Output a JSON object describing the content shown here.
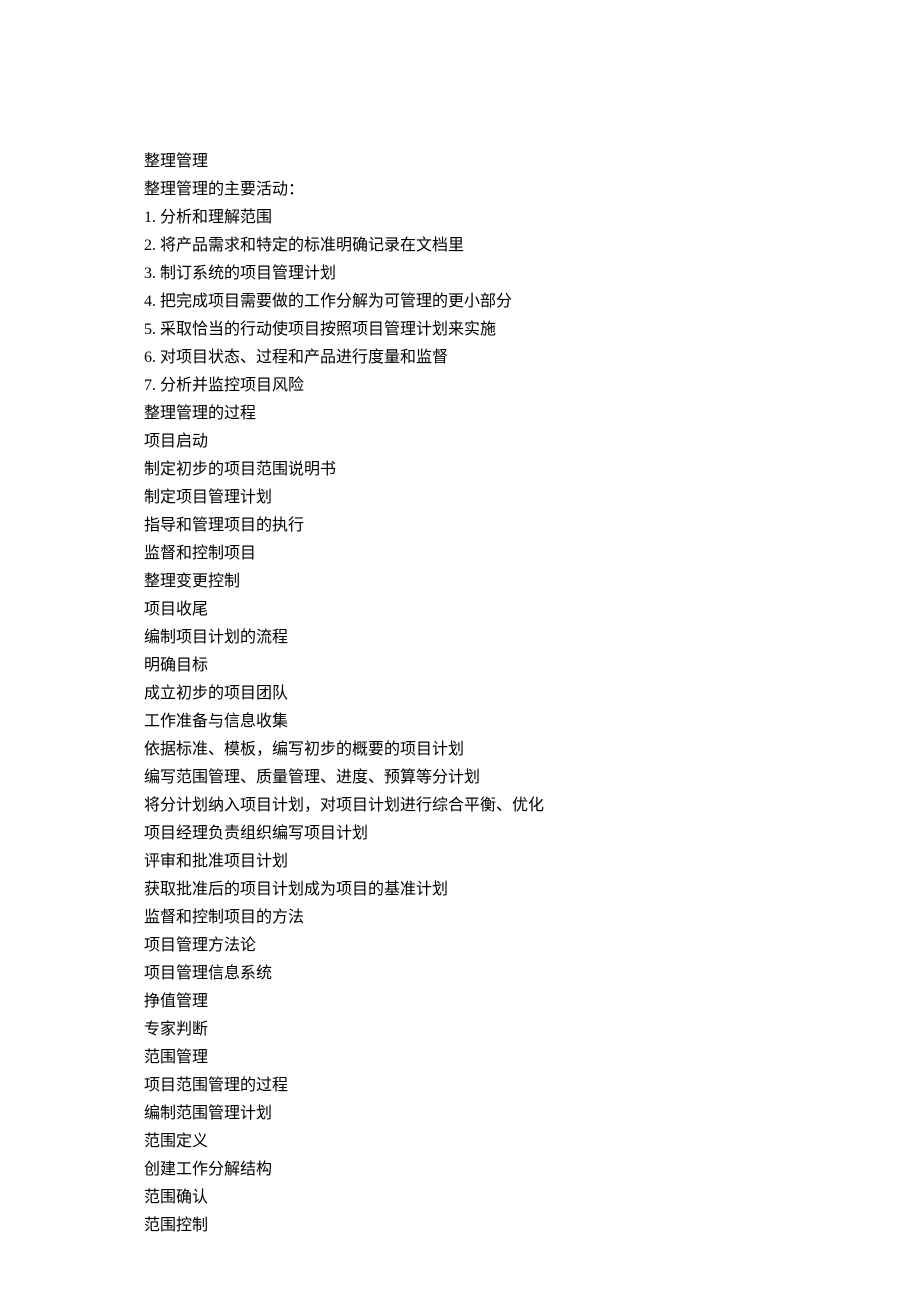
{
  "lines": [
    "整理管理",
    "整理管理的主要活动：",
    "1.  分析和理解范围",
    "2.  将产品需求和特定的标准明确记录在文档里",
    "3.  制订系统的项目管理计划",
    "4.  把完成项目需要做的工作分解为可管理的更小部分",
    "5.  采取恰当的行动使项目按照项目管理计划来实施",
    "6.  对项目状态、过程和产品进行度量和监督",
    "7.  分析并监控项目风险",
    "整理管理的过程",
    "项目启动",
    "制定初步的项目范围说明书",
    "制定项目管理计划",
    "指导和管理项目的执行",
    "监督和控制项目",
    "整理变更控制",
    "项目收尾",
    "编制项目计划的流程",
    "明确目标",
    "成立初步的项目团队",
    "工作准备与信息收集",
    "依据标准、模板，编写初步的概要的项目计划",
    "编写范围管理、质量管理、进度、预算等分计划",
    "将分计划纳入项目计划，对项目计划进行综合平衡、优化",
    "项目经理负责组织编写项目计划",
    "评审和批准项目计划",
    "获取批准后的项目计划成为项目的基准计划",
    "监督和控制项目的方法",
    "项目管理方法论",
    "项目管理信息系统",
    "挣值管理",
    "专家判断",
    "范围管理",
    "项目范围管理的过程",
    "编制范围管理计划",
    "范围定义",
    "创建工作分解结构",
    "范围确认",
    "范围控制"
  ]
}
